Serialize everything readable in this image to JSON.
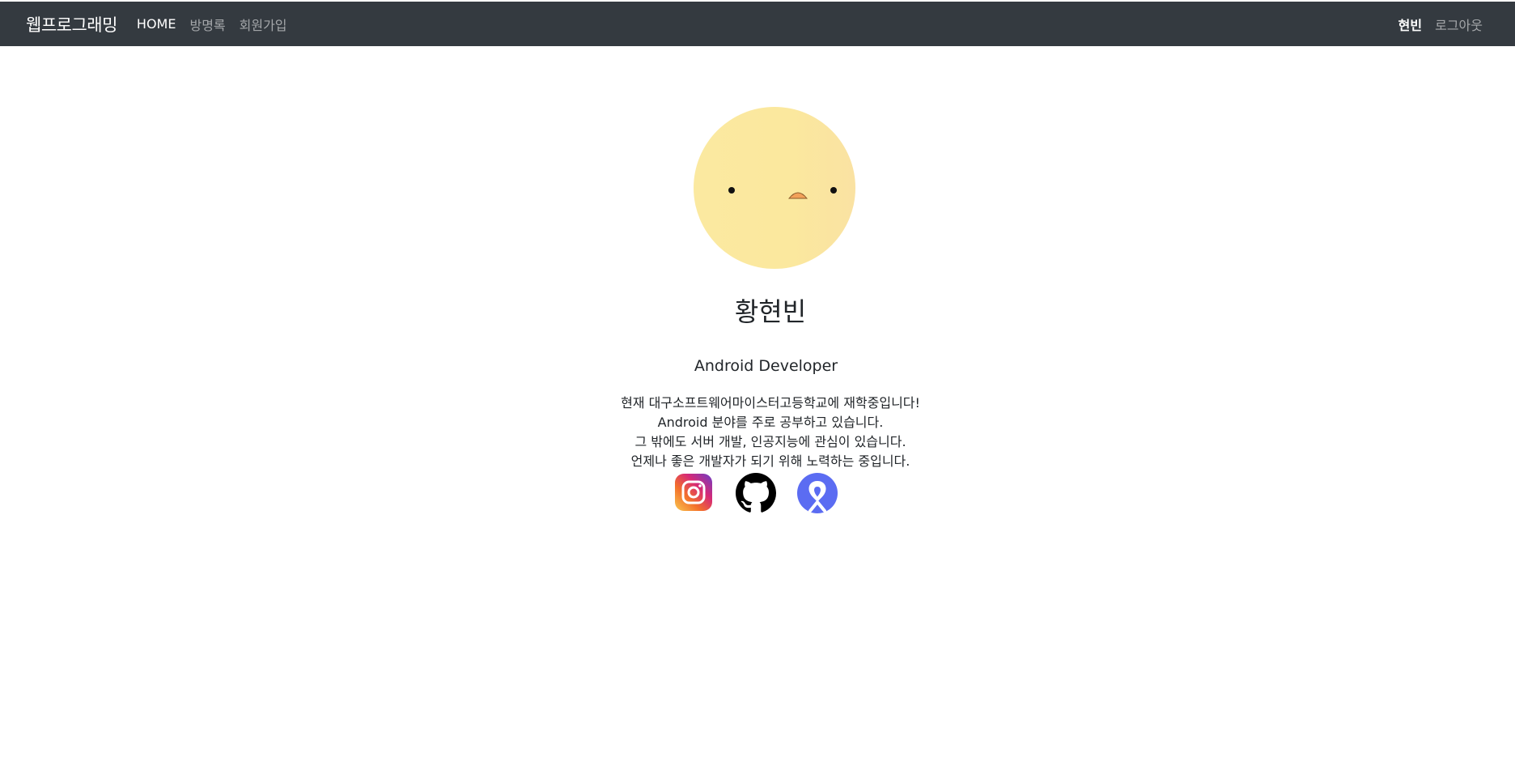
{
  "navbar": {
    "brand": "웹프로그래밍",
    "links": [
      {
        "label": "HOME",
        "active": true
      },
      {
        "label": "방명록",
        "active": false
      },
      {
        "label": "회원가입",
        "active": false
      }
    ],
    "user": "현빈",
    "logout": "로그아웃",
    "background": "#343a40"
  },
  "profile": {
    "avatar_icon": "chick-face-icon",
    "name": "황현빈",
    "role": "Android Developer",
    "bio": [
      "현재 대구소프트웨어마이스터고등학교에 재학중입니다!",
      "Android 분야를 주로 공부하고 있습니다.",
      "그 밖에도 서버 개발, 인공지능에 관심이 있습니다.",
      "언제나 좋은 개발자가 되기 위해 노력하는 중입니다."
    ],
    "socials": [
      {
        "icon": "instagram-icon"
      },
      {
        "icon": "github-icon"
      },
      {
        "icon": "velog-icon"
      }
    ]
  }
}
